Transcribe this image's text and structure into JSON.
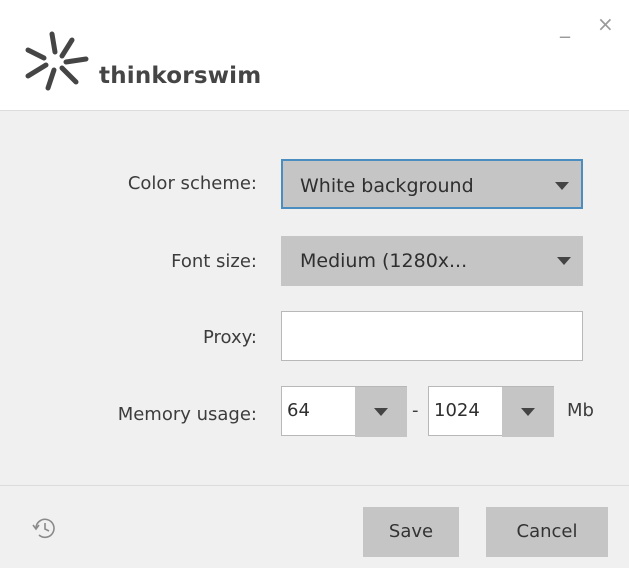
{
  "app": {
    "brand": "thinkorswim"
  },
  "window": {
    "minimize_glyph": "_",
    "close_glyph": "×"
  },
  "form": {
    "color_scheme": {
      "label": "Color scheme:",
      "value": "White background"
    },
    "font_size": {
      "label": "Font size:",
      "value": "Medium (1280x..."
    },
    "proxy": {
      "label": "Proxy:",
      "value": ""
    },
    "memory": {
      "label": "Memory usage:",
      "min": "64",
      "max": "1024",
      "separator": "-",
      "unit": "Mb"
    }
  },
  "footer": {
    "save_label": "Save",
    "cancel_label": "Cancel",
    "history_icon": "history-icon"
  },
  "colors": {
    "accent": "#4c8dc0",
    "select_bg": "#c4c5c4",
    "panel_bg": "#f0f0f0",
    "logo": "#454545"
  }
}
